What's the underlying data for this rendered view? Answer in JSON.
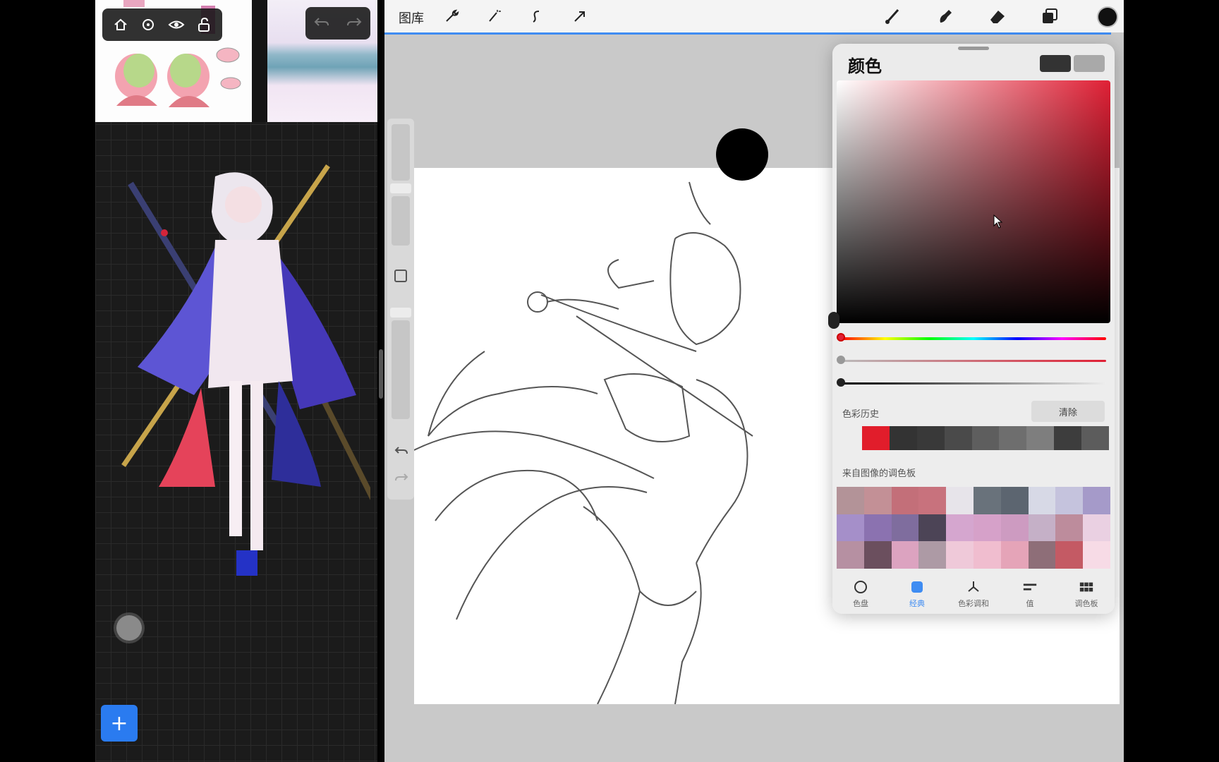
{
  "reference": {
    "toolbar_icons": [
      "home-icon",
      "settings-icon",
      "eye-icon",
      "unlock-icon"
    ],
    "undo_icons": [
      "undo-icon",
      "redo-icon"
    ],
    "add_label": "+"
  },
  "procreate": {
    "gallery_label": "图库",
    "toolbar_icons": [
      "wrench-icon",
      "magic-wand-icon",
      "selection-icon",
      "transform-icon",
      "brush-icon",
      "smudge-icon",
      "eraser-icon",
      "layers-icon"
    ],
    "current_color": "#111111"
  },
  "color_panel": {
    "title": "颜色",
    "primary_swatch": "#333333",
    "secondary_swatch": "#a9a9a9",
    "hue_color": "#e02035",
    "history_label": "色彩历史",
    "clear_label": "清除",
    "history_colors": [
      "#e11d2b",
      "#333333",
      "#393939",
      "#4a4a4a",
      "#5e5e5e",
      "#6e6e6e",
      "#7e7e7e",
      "#3d3d3d",
      "#5c5c5c"
    ],
    "image_palette_label": "来自图像的调色板",
    "image_palette": [
      "#b39398",
      "#c39096",
      "#c36f79",
      "#c8727d",
      "#e7e4ea",
      "#69727b",
      "#5c6570",
      "#d7d9e6",
      "#c5c3dd",
      "#a59ac9",
      "#a58fc9",
      "#8b72b0",
      "#7f6d9e",
      "#4c4456",
      "#d5a6cf",
      "#d6a1c9",
      "#cd9bc1",
      "#c5b0c7",
      "#bd8c9c",
      "#ead0e2",
      "#b690a2",
      "#6b4f5e",
      "#dca3c0",
      "#ad9aa5",
      "#efc9d9",
      "#f0bdcf",
      "#e5a4b8",
      "#8e6e78",
      "#c45a64",
      "#f7dbe6"
    ],
    "tabs": [
      {
        "label": "色盘",
        "icon": "disc-icon"
      },
      {
        "label": "经典",
        "icon": "square-icon"
      },
      {
        "label": "色彩调和",
        "icon": "harmony-icon"
      },
      {
        "label": "值",
        "icon": "value-sliders-icon"
      },
      {
        "label": "调色板",
        "icon": "palette-grid-icon"
      }
    ]
  }
}
